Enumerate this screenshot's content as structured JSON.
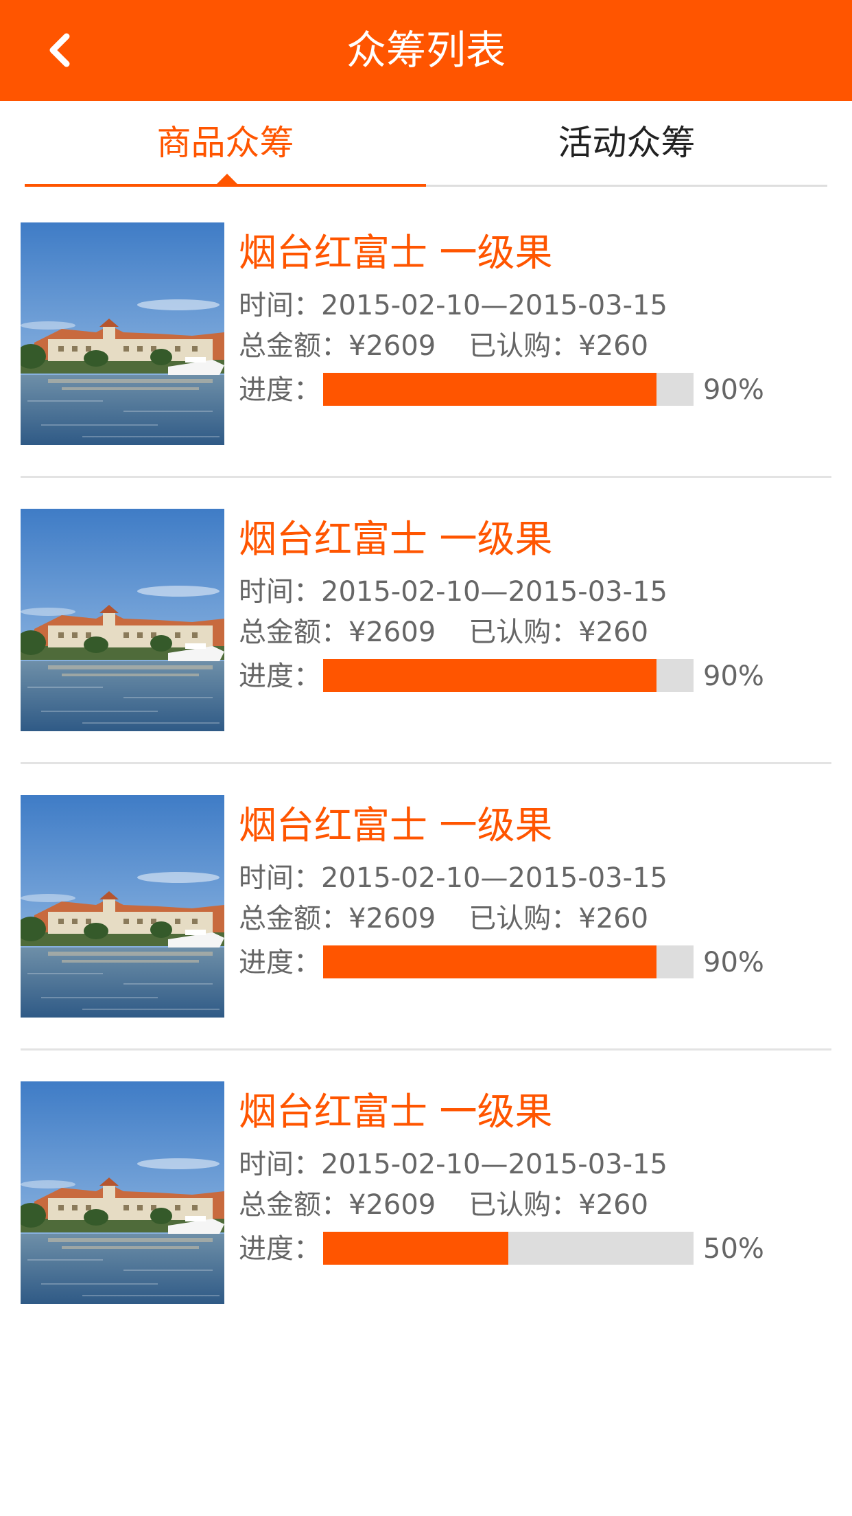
{
  "header": {
    "title": "众筹列表",
    "back_icon": "chevron-left-icon",
    "background_color": "#ff5500"
  },
  "tabs": [
    {
      "label": "商品众筹",
      "active": true
    },
    {
      "label": "活动众筹",
      "active": false
    }
  ],
  "accent_color": "#ff5500",
  "items": [
    {
      "title": "烟台红富士 一级果",
      "time_label": "时间：",
      "time": "2015-02-10—2015-03-15",
      "total_label": "总金额：",
      "total": "¥2609",
      "subscribed_label": "已认购：",
      "subscribed": "¥260",
      "progress_label": "进度：",
      "progress": 90,
      "progress_text": "90%"
    },
    {
      "title": "烟台红富士 一级果",
      "time_label": "时间：",
      "time": "2015-02-10—2015-03-15",
      "total_label": "总金额：",
      "total": "¥2609",
      "subscribed_label": "已认购：",
      "subscribed": "¥260",
      "progress_label": "进度：",
      "progress": 90,
      "progress_text": "90%"
    },
    {
      "title": "烟台红富士 一级果",
      "time_label": "时间：",
      "time": "2015-02-10—2015-03-15",
      "total_label": "总金额：",
      "total": "¥2609",
      "subscribed_label": "已认购：",
      "subscribed": "¥260",
      "progress_label": "进度：",
      "progress": 90,
      "progress_text": "90%"
    },
    {
      "title": "烟台红富士 一级果",
      "time_label": "时间：",
      "time": "2015-02-10—2015-03-15",
      "total_label": "总金额：",
      "total": "¥2609",
      "subscribed_label": "已认购：",
      "subscribed": "¥260",
      "progress_label": "进度：",
      "progress": 50,
      "progress_text": "50%"
    }
  ]
}
